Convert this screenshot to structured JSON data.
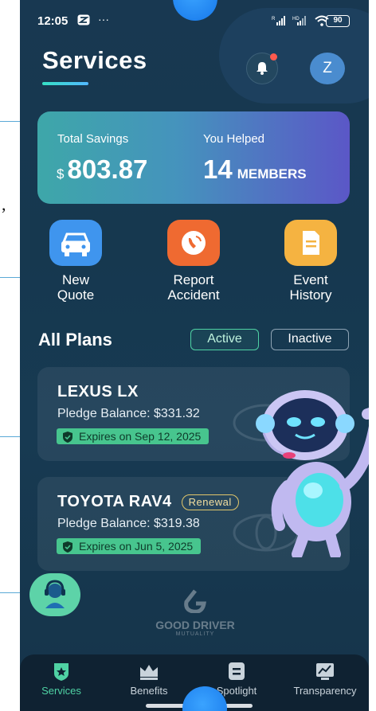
{
  "status_bar": {
    "time": "12:05",
    "battery": "90"
  },
  "header": {
    "title": "Services",
    "avatar_initial": "Z"
  },
  "savings_card": {
    "total_savings_label": "Total Savings",
    "currency_symbol": "$",
    "total_savings_value": "803.87",
    "helped_label": "You Helped",
    "helped_count": "14",
    "helped_unit": "MEMBERS"
  },
  "quick_actions": [
    {
      "label": "New\nQuote",
      "icon": "car-icon",
      "color": "#3f95ee"
    },
    {
      "label": "Report\nAccident",
      "icon": "phone-call-icon",
      "color": "#ef6a31"
    },
    {
      "label": "Event\nHistory",
      "icon": "document-icon",
      "color": "#f5b341"
    }
  ],
  "plans": {
    "title": "All Plans",
    "tabs": {
      "active": "Active",
      "inactive": "Inactive"
    },
    "items": [
      {
        "name": "LEXUS LX",
        "balance": "Pledge Balance: $331.32",
        "expiry": "Expires on Sep 12, 2025",
        "badge": ""
      },
      {
        "name": "TOYOTA RAV4",
        "balance": "Pledge Balance: $319.38",
        "expiry": "Expires on Jun 5, 2025",
        "badge": "Renewal"
      }
    ]
  },
  "brand": {
    "name": "GOOD DRIVER",
    "sub": "MUTUALITY"
  },
  "nav": [
    {
      "label": "Services",
      "icon": "star-shield-icon",
      "active": true
    },
    {
      "label": "Benefits",
      "icon": "crown-icon",
      "active": false
    },
    {
      "label": "Spotlight",
      "icon": "list-icon",
      "active": false
    },
    {
      "label": "Transparency",
      "icon": "chart-board-icon",
      "active": false
    }
  ],
  "colors": {
    "accent": "#4fd2a4",
    "background": "#173a52",
    "notification": "#ff5a4e"
  }
}
